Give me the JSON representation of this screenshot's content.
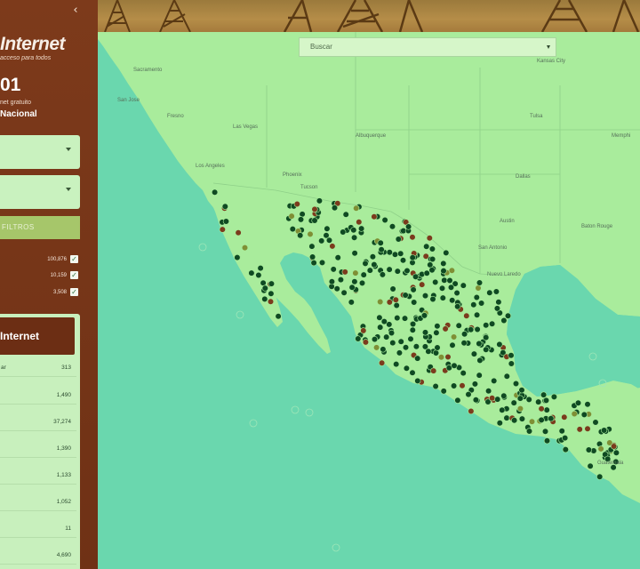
{
  "sidebar": {
    "collapse_icon": "‹",
    "brand_name": "Internet",
    "brand_tagline": "acceso para todos",
    "total_number": "01",
    "total_sub": "net gratuito",
    "total_scope": "Nacional",
    "filter_label": "FILTROS",
    "layers": [
      {
        "count": "100,876",
        "checked": true
      },
      {
        "count": "10,159",
        "checked": true
      },
      {
        "count": "3,508",
        "checked": true
      }
    ],
    "stats_title": "Internet",
    "stats": [
      {
        "label": "ar",
        "value": "313"
      },
      {
        "label": "",
        "value": "1,490"
      },
      {
        "label": "",
        "value": "37,274"
      },
      {
        "label": "",
        "value": "1,390"
      },
      {
        "label": "",
        "value": "1,133"
      },
      {
        "label": "",
        "value": "1,052"
      },
      {
        "label": "",
        "value": "11"
      },
      {
        "label": "",
        "value": "4,690"
      }
    ]
  },
  "map": {
    "search_placeholder": "Buscar",
    "labels": {
      "sacramento": "Sacramento",
      "san_jose": "San Jose",
      "fresno": "Fresno",
      "las_vegas": "Las Vegas",
      "los_angeles": "Los Angeles",
      "phoenix": "Phoenix",
      "tucson": "Tucson",
      "albuquerque": "Albuquerque",
      "kansas_city": "Kansas City",
      "tulsa": "Tulsa",
      "memphis": "Memphi",
      "dallas": "Dallas",
      "austin": "Austin",
      "san_antonio": "San Antonio",
      "baton_rouge": "Baton Rouge",
      "nuevo_laredo": "Nuevo Laredo",
      "guatemala": "Guatemala"
    },
    "colors": {
      "water": "#6ad7ae",
      "land": "#a9ec9c",
      "dot_green": "#0f4a22",
      "dot_red": "#7b3b1d",
      "dot_olive": "#7f8f35"
    }
  }
}
